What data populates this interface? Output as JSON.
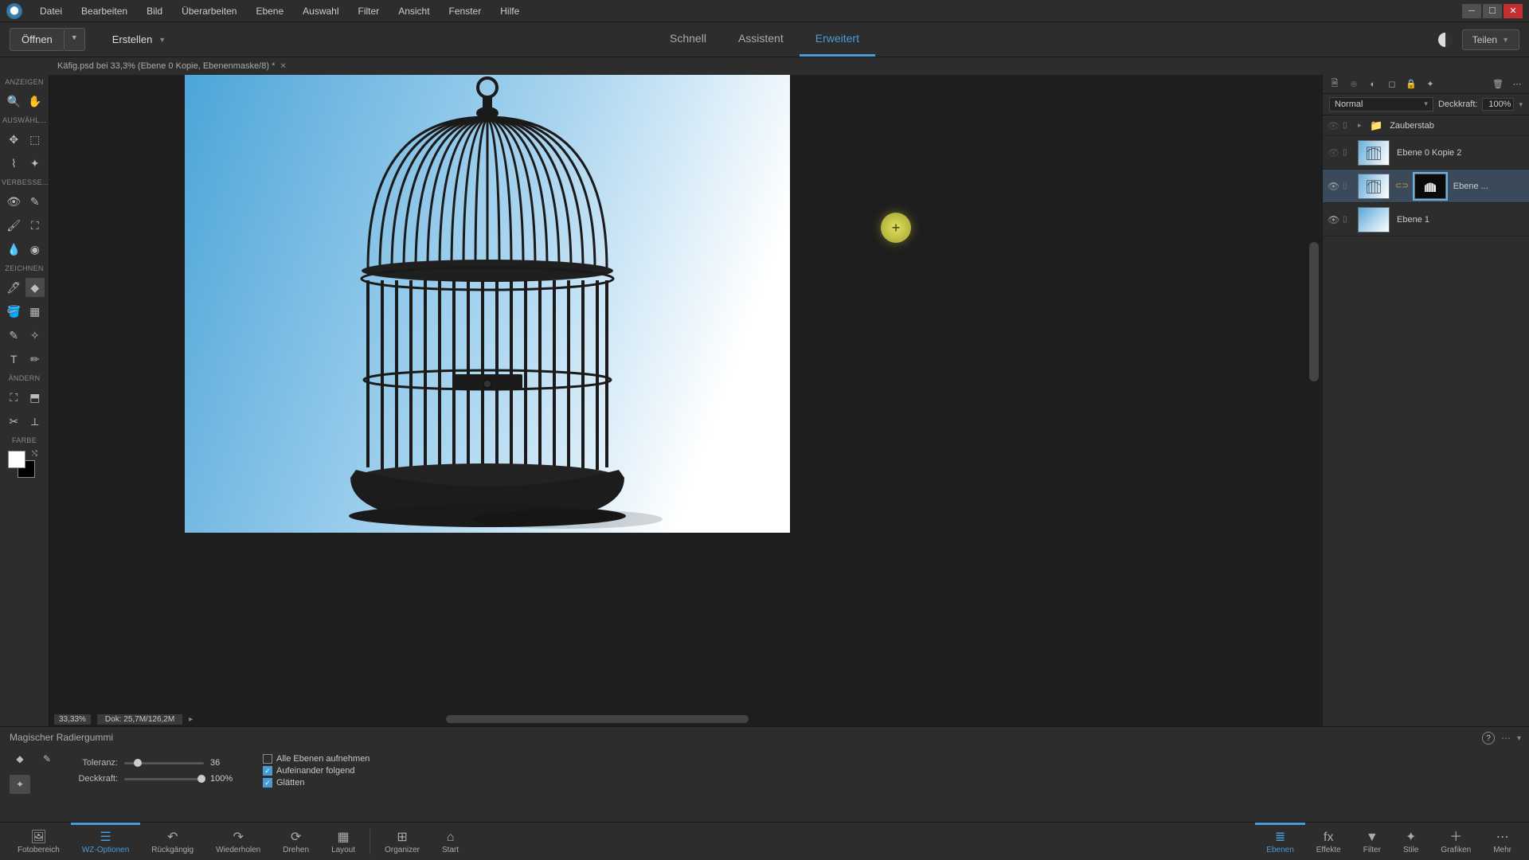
{
  "menu": {
    "items": [
      "Datei",
      "Bearbeiten",
      "Bild",
      "Überarbeiten",
      "Ebene",
      "Auswahl",
      "Filter",
      "Ansicht",
      "Fenster",
      "Hilfe"
    ]
  },
  "actionbar": {
    "open": "Öffnen",
    "create": "Erstellen",
    "modes": [
      "Schnell",
      "Assistent",
      "Erweitert"
    ],
    "share": "Teilen"
  },
  "doc_tab": "Käfig.psd bei 33,3% (Ebene 0 Kopie, Ebenenmaske/8) *",
  "toolbox": {
    "sections": {
      "view": "ANZEIGEN",
      "select": "AUSWÄHL...",
      "enhance": "VERBESSE...",
      "draw": "ZEICHNEN",
      "modify": "ÄNDERN",
      "color": "FARBE"
    }
  },
  "canvas": {
    "zoom": "33,33%",
    "doc_size": "Dok: 25,7M/126,2M"
  },
  "layers_panel": {
    "blend_mode": "Normal",
    "opacity_label": "Deckkraft:",
    "opacity_value": "100%",
    "layers": [
      {
        "name": "Zauberstab",
        "type": "group"
      },
      {
        "name": "Ebene 0 Kopie 2",
        "type": "layer"
      },
      {
        "name": "Ebene ...",
        "type": "masked",
        "selected": true
      },
      {
        "name": "Ebene 1",
        "type": "gradient"
      }
    ]
  },
  "tool_options": {
    "title": "Magischer Radiergummi",
    "tolerance_label": "Toleranz:",
    "tolerance_value": "36",
    "opacity_label": "Deckkraft:",
    "opacity_value": "100%",
    "checks": {
      "all_layers": "Alle Ebenen aufnehmen",
      "contiguous": "Aufeinander folgend",
      "antialias": "Glätten"
    }
  },
  "bottom_bar": {
    "left": [
      "Fotobereich",
      "WZ-Optionen",
      "Rückgängig",
      "Wiederholen",
      "Drehen",
      "Layout",
      "Organizer",
      "Start"
    ],
    "right": [
      "Ebenen",
      "Effekte",
      "Filter",
      "Stile",
      "Grafiken",
      "Mehr"
    ]
  }
}
